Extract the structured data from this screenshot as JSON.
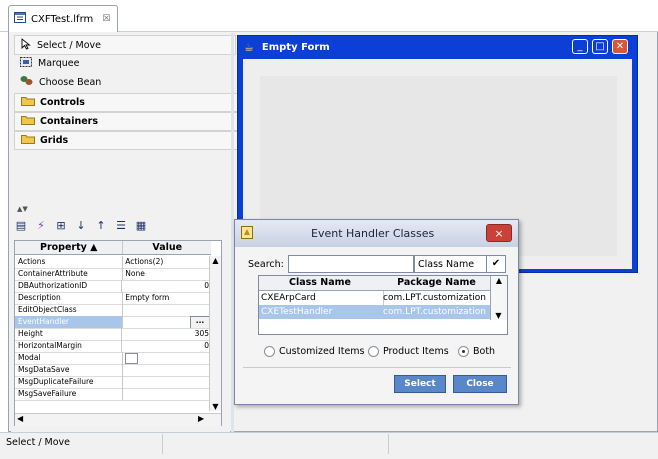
{
  "editor_tab": {
    "title": "CXFTest.lfrm",
    "close": "☒"
  },
  "palette": {
    "items": [
      {
        "label": "Select / Move",
        "icon": "arrow-cursor-icon"
      },
      {
        "label": "Marquee",
        "icon": "marquee-icon"
      },
      {
        "label": "Choose Bean",
        "icon": "bean-icon"
      }
    ],
    "categories": [
      {
        "label": "Controls",
        "icon": "folder-icon"
      },
      {
        "label": "Containers",
        "icon": "folder-icon"
      },
      {
        "label": "Grids",
        "icon": "folder-icon"
      }
    ]
  },
  "properties": {
    "columns": {
      "name": "Property",
      "value": "Value"
    },
    "rows": [
      {
        "name": "Actions",
        "value": "Actions(2)"
      },
      {
        "name": "ContainerAttribute",
        "value": "None"
      },
      {
        "name": "DBAuthorizationID",
        "value": "0"
      },
      {
        "name": "Description",
        "value": "Empty form"
      },
      {
        "name": "EditObjectClass",
        "value": ""
      },
      {
        "name": "EventHandler",
        "value": ""
      },
      {
        "name": "Height",
        "value": "305"
      },
      {
        "name": "HorizontalMargin",
        "value": "0"
      },
      {
        "name": "Modal",
        "value": ""
      },
      {
        "name": "MsgDataSave",
        "value": ""
      },
      {
        "name": "MsgDuplicateFailure",
        "value": ""
      },
      {
        "name": "MsgSaveFailure",
        "value": ""
      }
    ],
    "ellipsis": "..."
  },
  "form": {
    "title": "Empty Form"
  },
  "dialog": {
    "title": "Event Handler Classes",
    "close": "×",
    "search_label": "Search:",
    "search_value": "",
    "search_by": "Class Name",
    "columns": {
      "class": "Class Name",
      "package": "Package Name"
    },
    "rows": [
      {
        "class": "CXEArpCard",
        "package": "com.LPT.customization"
      },
      {
        "class": "CXETestHandler",
        "package": "com.LPT.customization"
      }
    ],
    "radios": [
      "Customized Items",
      "Product Items",
      "Both"
    ],
    "radio_selected": "Both",
    "select_label": "Select",
    "close_label": "Close"
  },
  "status": {
    "text": "Select / Move"
  },
  "colors": {
    "form_title_bar": "#0b3fd6",
    "dialog_button": "#5a87c9",
    "selection": "#a8c5ea"
  }
}
